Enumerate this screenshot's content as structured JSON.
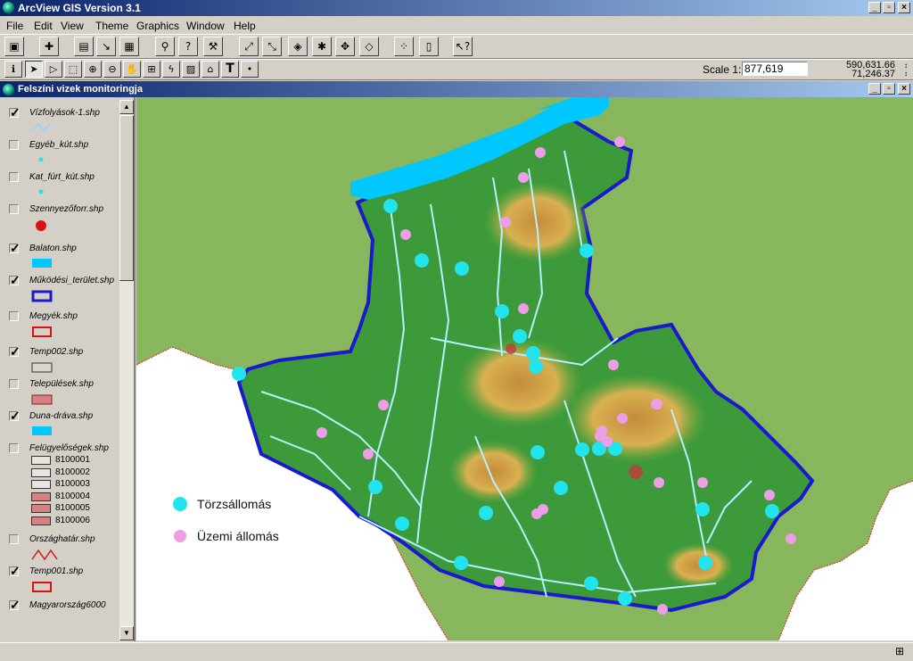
{
  "app": {
    "title": "ArcView GIS Version 3.1",
    "min_label": "_",
    "restore_label": "▫",
    "close_label": "×"
  },
  "menus": [
    "File",
    "Edit",
    "View",
    "Theme",
    "Graphics",
    "Window",
    "Help"
  ],
  "toolbar": {
    "scale_label": "Scale 1:",
    "scale_value": "877,619",
    "coord_x": "590,631.66",
    "coord_y": "71,246.37",
    "text_tool": "T"
  },
  "view": {
    "title": "Felszíni vizek monitoringja"
  },
  "themes": [
    {
      "name": "Vízfolyások-1.shp",
      "checked": true,
      "symbol": "line-lightblue"
    },
    {
      "name": "Egyéb_kút.shp",
      "checked": false,
      "symbol": "dot-cyan"
    },
    {
      "name": "Kat_fúrt_kút.shp",
      "checked": false,
      "symbol": "dot-cyan"
    },
    {
      "name": "Szennyezőforr.shp",
      "checked": false,
      "symbol": "dot-red"
    },
    {
      "name": "Balaton.shp",
      "checked": true,
      "symbol": "fill-cyan"
    },
    {
      "name": "Működési_terület.shp",
      "checked": true,
      "symbol": "outline-blue"
    },
    {
      "name": "Megyék.shp",
      "checked": false,
      "symbol": "outline-red"
    },
    {
      "name": "Temp002.shp",
      "checked": true,
      "symbol": "fill-grey"
    },
    {
      "name": "Települések.shp",
      "checked": false,
      "symbol": "fill-hatch"
    },
    {
      "name": "Duna-dráva.shp",
      "checked": true,
      "symbol": "fill-cyan"
    },
    {
      "name": "Felügyelőségek.shp",
      "checked": false,
      "symbol": "none"
    },
    {
      "name": "Országhatár.shp",
      "checked": false,
      "symbol": "line-red"
    },
    {
      "name": "Temp001.shp",
      "checked": true,
      "symbol": "outline-red"
    },
    {
      "name": "Magyarország6000",
      "checked": true,
      "symbol": "none"
    }
  ],
  "felugyelosegek_classes": [
    {
      "label": "8100001",
      "color": "#e8e6e0"
    },
    {
      "label": "8100002",
      "color": "#e8e6e0"
    },
    {
      "label": "8100003",
      "color": "#e8e6e0"
    },
    {
      "label": "8100004",
      "color": "#d98080"
    },
    {
      "label": "8100005",
      "color": "#d98080"
    },
    {
      "label": "8100006",
      "color": "#d98080"
    }
  ],
  "legend": {
    "torzs": "Törzsállomás",
    "uzemi": "Üzemi állomás"
  },
  "colors": {
    "torzs": "#21e4ee",
    "uzemi": "#ee9ee9",
    "boundary": "#1a1acc",
    "lake": "#00c8ff",
    "terrain": "#3d9a3a"
  }
}
